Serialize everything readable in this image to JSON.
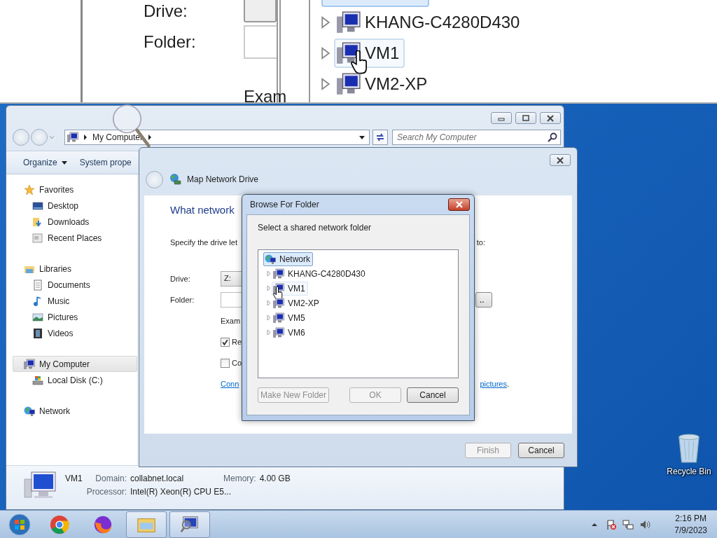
{
  "inset": {
    "drive_label": "Drive:",
    "folder_label": "Folder:",
    "example_label": "Exam",
    "tree": [
      {
        "label": "KHANG-C4280D430",
        "hovered": false
      },
      {
        "label": "VM1",
        "hovered": true
      },
      {
        "label": "VM2-XP",
        "hovered": false
      }
    ]
  },
  "explorer": {
    "address": [
      "My Computer"
    ],
    "search_placeholder": "Search My Computer",
    "toolbar": [
      {
        "label": "Organize",
        "dropdown": true
      },
      {
        "label": "System prope",
        "dropdown": false
      }
    ],
    "nav": [
      {
        "label": "Favorites",
        "kind": "star",
        "selected": false,
        "children": [
          {
            "label": "Desktop",
            "kind": "desktop",
            "selected": false
          },
          {
            "label": "Downloads",
            "kind": "downloads",
            "selected": false
          },
          {
            "label": "Recent Places",
            "kind": "recent",
            "selected": false
          }
        ]
      },
      {
        "label": "Libraries",
        "kind": "library",
        "selected": false,
        "children": [
          {
            "label": "Documents",
            "kind": "document",
            "selected": false
          },
          {
            "label": "Music",
            "kind": "music",
            "selected": false
          },
          {
            "label": "Pictures",
            "kind": "pictures",
            "selected": false
          },
          {
            "label": "Videos",
            "kind": "videos",
            "selected": false
          }
        ]
      },
      {
        "label": "My Computer",
        "kind": "computer",
        "selected": true,
        "children": [
          {
            "label": "Local Disk (C:)",
            "kind": "disk",
            "selected": false
          }
        ]
      },
      {
        "label": "Network",
        "kind": "network",
        "selected": false
      }
    ],
    "details": {
      "name": "VM1",
      "fields": [
        {
          "label": "Domain:",
          "value": "collabnet.local"
        },
        {
          "label": "Memory:",
          "value": "4.00 GB"
        },
        {
          "label": "Processor:",
          "value": "Intel(R) Xeon(R) CPU E5..."
        }
      ]
    }
  },
  "map": {
    "title": "Map Network Drive",
    "heading": "What network",
    "instruction_start": "Specify the drive let",
    "instruction_end": "to:",
    "drive_label": "Drive:",
    "drive_value": "Z:",
    "folder_label": "Folder:",
    "browse_visible": "..",
    "example": "Exam",
    "options": [
      {
        "label": "Re",
        "checked": true
      },
      {
        "label": "Co",
        "checked": false
      }
    ],
    "link_start": "Conn",
    "link_end": "pictures",
    "link_end_punct": ".",
    "buttons": [
      {
        "label": "Finish",
        "disabled": true
      },
      {
        "label": "Cancel",
        "disabled": false
      }
    ]
  },
  "browse": {
    "title": "Browse For Folder",
    "prompt": "Select a shared network folder",
    "root": {
      "label": "Network",
      "selected": true,
      "children": [
        {
          "label": "KHANG-C4280D430",
          "selected": false,
          "hovered": false,
          "expanded": false
        },
        {
          "label": "VM1",
          "selected": false,
          "hovered": true,
          "expanded": false
        },
        {
          "label": "VM2-XP",
          "selected": false,
          "hovered": false,
          "expanded": false
        },
        {
          "label": "VM5",
          "selected": false,
          "hovered": false,
          "expanded": false
        },
        {
          "label": "VM6",
          "selected": false,
          "hovered": false,
          "expanded": false
        }
      ]
    },
    "buttons": [
      {
        "label": "Make New Folder",
        "disabled": true
      },
      {
        "label": "OK",
        "disabled": true
      },
      {
        "label": "Cancel",
        "disabled": false
      }
    ]
  },
  "desktop": {
    "icons": [
      {
        "label": "Recycle Bin"
      }
    ]
  },
  "taskbar": {
    "apps": [
      {
        "kind": "chrome",
        "open": false
      },
      {
        "kind": "firefox",
        "open": false
      },
      {
        "kind": "explorer",
        "open": true
      },
      {
        "kind": "computer",
        "open": true
      }
    ],
    "tray": [
      {
        "kind": "show-hidden"
      },
      {
        "kind": "flag"
      },
      {
        "kind": "network"
      },
      {
        "kind": "volume"
      }
    ],
    "time": "2:16 PM",
    "date": "7/9/2023"
  }
}
